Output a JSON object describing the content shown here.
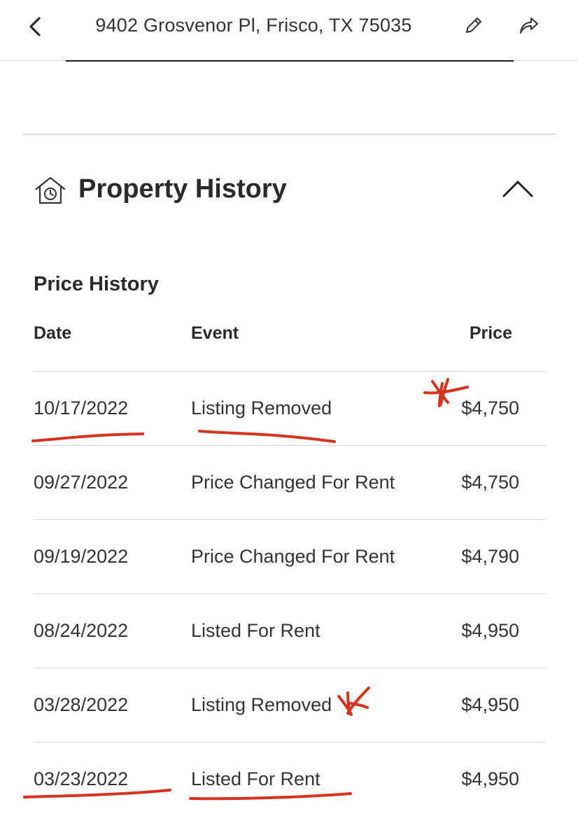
{
  "header": {
    "address": "9402 Grosvenor Pl, Frisco, TX 75035",
    "back_icon": "chevron-left-icon",
    "edit_icon": "pencil-icon",
    "share_icon": "share-arrow-icon"
  },
  "property_history": {
    "title": "Property History",
    "icon": "house-clock-icon",
    "toggle_icon": "chevron-up-icon"
  },
  "price_history": {
    "title": "Price History",
    "columns": {
      "date": "Date",
      "event": "Event",
      "price": "Price"
    },
    "rows": [
      {
        "date": "10/17/2022",
        "event": "Listing Removed",
        "price": "$4,750"
      },
      {
        "date": "09/27/2022",
        "event": "Price Changed For Rent",
        "price": "$4,750"
      },
      {
        "date": "09/19/2022",
        "event": "Price Changed For Rent",
        "price": "$4,790"
      },
      {
        "date": "08/24/2022",
        "event": "Listed For Rent",
        "price": "$4,950"
      },
      {
        "date": "03/28/2022",
        "event": "Listing Removed",
        "price": "$4,950"
      },
      {
        "date": "03/23/2022",
        "event": "Listed For Rent",
        "price": "$4,950"
      }
    ]
  },
  "colors": {
    "text": "#2a2a2a",
    "divider": "#d6d6d6",
    "markup": "#d7321e"
  }
}
